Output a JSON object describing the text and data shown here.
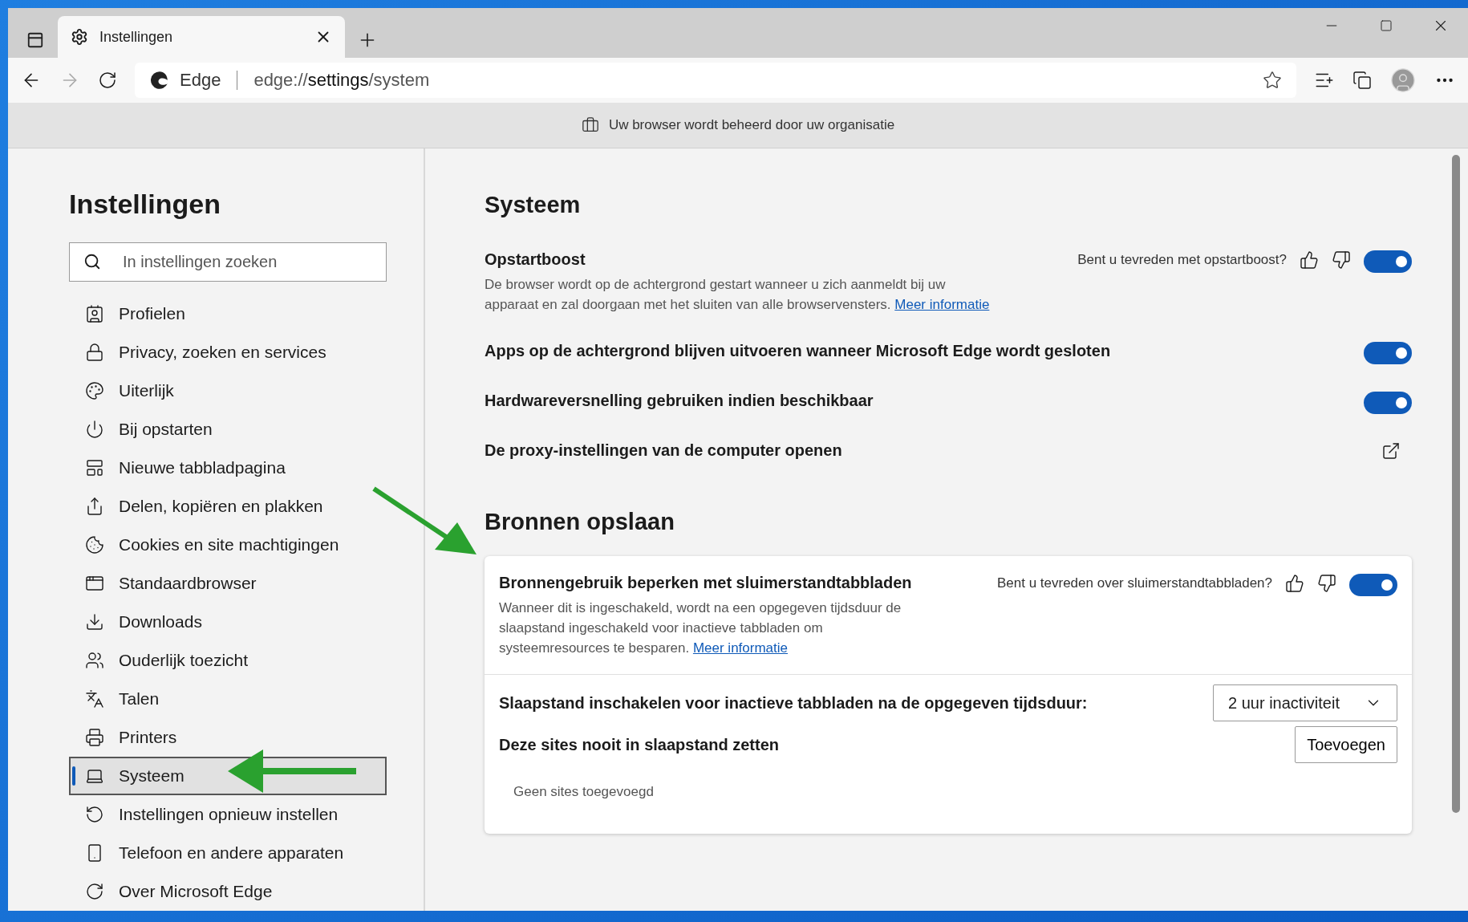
{
  "browser": {
    "tab": {
      "title": "Instellingen"
    },
    "address": {
      "site": "Edge",
      "url": "edge://**settings**/system"
    }
  },
  "banner": "Uw browser wordt beheerd door uw organisatie",
  "sidebar": {
    "title": "Instellingen",
    "search": {
      "placeholder": "In instellingen zoeken"
    },
    "items": [
      {
        "label": "Profielen",
        "selected": false
      },
      {
        "label": "Privacy, zoeken en services",
        "selected": false
      },
      {
        "label": "Uiterlijk",
        "selected": false
      },
      {
        "label": "Bij opstarten",
        "selected": false
      },
      {
        "label": "Nieuwe tabbladpagina",
        "selected": false
      },
      {
        "label": "Delen, kopiëren en plakken",
        "selected": false
      },
      {
        "label": "Cookies en site machtigingen",
        "selected": false
      },
      {
        "label": "Standaardbrowser",
        "selected": false
      },
      {
        "label": "Downloads",
        "selected": false
      },
      {
        "label": "Ouderlijk toezicht",
        "selected": false
      },
      {
        "label": "Talen",
        "selected": false
      },
      {
        "label": "Printers",
        "selected": false
      },
      {
        "label": "Systeem",
        "selected": true
      },
      {
        "label": "Instellingen opnieuw instellen",
        "selected": false
      },
      {
        "label": "Telefoon en andere apparaten",
        "selected": false
      },
      {
        "label": "Over Microsoft Edge",
        "selected": false
      }
    ]
  },
  "system": {
    "title": "Systeem",
    "settings": [
      {
        "kind": "toggle",
        "label": "Opstartboost",
        "question": "Bent u tevreden met opstartboost?",
        "description": "De browser wordt op de achtergrond gestart wanneer u zich aanmeldt bij uw apparaat en zal doorgaan met het sluiten van alle browservensters.",
        "link": "Meer informatie",
        "on": true
      },
      {
        "kind": "toggle",
        "label": "Apps op de achtergrond blijven uitvoeren wanneer Microsoft Edge wordt gesloten",
        "on": true
      },
      {
        "kind": "toggle",
        "label": "Hardwareversnelling gebruiken indien beschikbaar",
        "on": true
      },
      {
        "kind": "external",
        "label": "De proxy-instellingen van de computer openen"
      }
    ]
  },
  "resources": {
    "title": "Bronnen opslaan",
    "card": {
      "label": "Bronnengebruik beperken met sluimerstandtabbladen",
      "question": "Bent u tevreden over sluimerstandtabbladen?",
      "description": "Wanneer dit is ingeschakeld, wordt na een opgegeven tijdsduur de slaapstand ingeschakeld voor inactieve tabbladen om systeemresources te besparen.",
      "link": "Meer informatie",
      "on": true,
      "timeout": {
        "label": "Slaapstand inschakelen voor inactieve tabbladen na de opgegeven tijdsduur:",
        "value": "2 uur inactiviteit"
      },
      "never": {
        "label": "Deze sites nooit in slaapstand zetten",
        "button": "Toevoegen",
        "empty": "Geen sites toegevoegd"
      }
    }
  }
}
